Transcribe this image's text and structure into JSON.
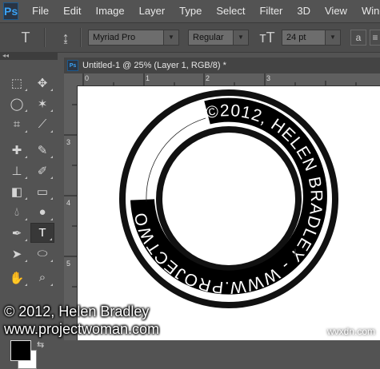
{
  "app": {
    "logo": "Ps"
  },
  "menu": [
    "File",
    "Edit",
    "Image",
    "Layer",
    "Type",
    "Select",
    "Filter",
    "3D",
    "View",
    "Window"
  ],
  "options": {
    "font_family": "Myriad Pro",
    "font_style": "Regular",
    "font_size": "24 pt",
    "aa_label": "a"
  },
  "document": {
    "title": "Untitled-1 @ 25% (Layer 1, RGB/8) *",
    "ruler_top": [
      "0",
      "1",
      "2",
      "3"
    ],
    "ruler_left": [
      "3",
      "4",
      "5"
    ]
  },
  "canvas": {
    "circle_text": "©2012, HELEN BRADLEY - WWW.PROJECTWOMAN.COM"
  },
  "watermark": {
    "line1": "© 2012, Helen Bradley",
    "line2": "www.projectwoman.com",
    "brand": "wvxdn.com"
  },
  "colors": {
    "foreground": "#000000",
    "background": "#ffffff",
    "ps_blue": "#3ba3f5"
  }
}
